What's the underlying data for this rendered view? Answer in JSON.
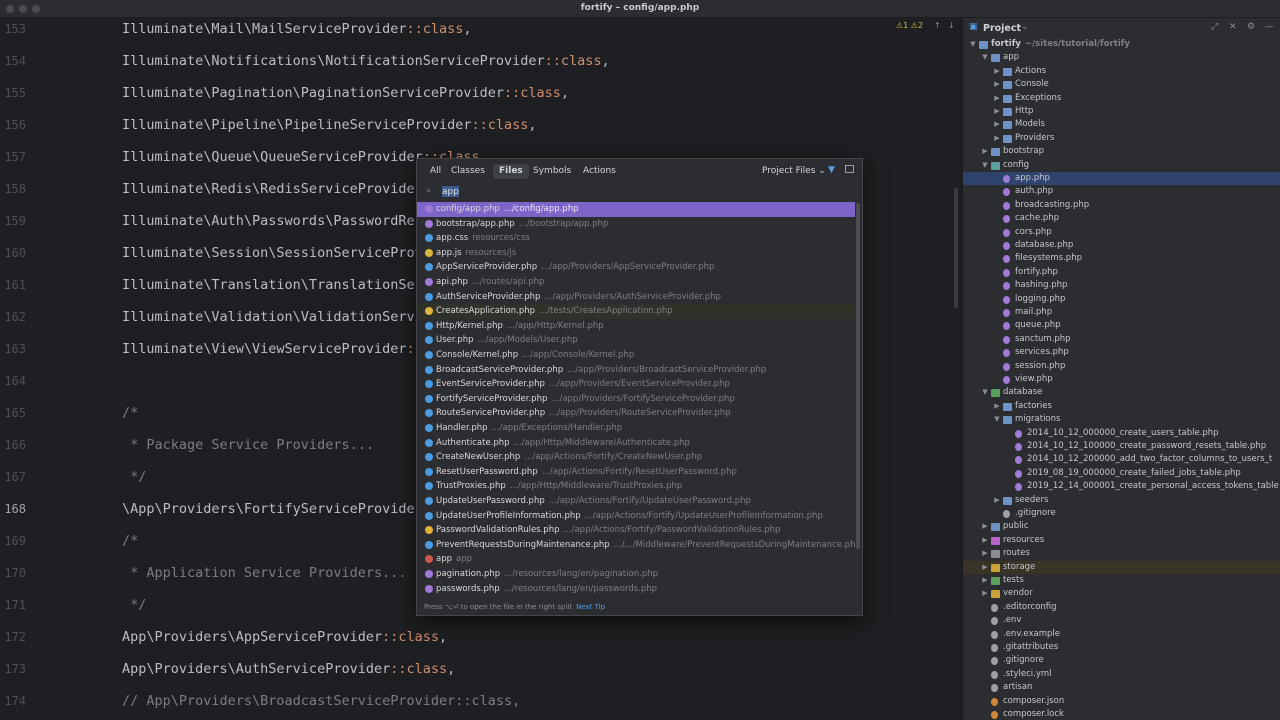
{
  "window": {
    "title": "fortify – config/app.php",
    "inspection_text": "⚠1 ⚠2"
  },
  "editor": {
    "lines": [
      {
        "num": "153",
        "code": "Illuminate\\Mail\\MailServiceProvider::class,"
      },
      {
        "num": "154",
        "code": "Illuminate\\Notifications\\NotificationServiceProvider::class,"
      },
      {
        "num": "155",
        "code": "Illuminate\\Pagination\\PaginationServiceProvider::class,"
      },
      {
        "num": "156",
        "code": "Illuminate\\Pipeline\\PipelineServiceProvider::class,"
      },
      {
        "num": "157",
        "code": "Illuminate\\Queue\\QueueServiceProvider::class,"
      },
      {
        "num": "158",
        "code": "Illuminate\\Redis\\RedisServiceProvider::class,"
      },
      {
        "num": "159",
        "code": "Illuminate\\Auth\\Passwords\\PasswordResetServiceProvider::class,"
      },
      {
        "num": "160",
        "code": "Illuminate\\Session\\SessionServiceProvider::class,"
      },
      {
        "num": "161",
        "code": "Illuminate\\Translation\\TranslationServiceProvider::class,"
      },
      {
        "num": "162",
        "code": "Illuminate\\Validation\\ValidationServiceProvider::class,"
      },
      {
        "num": "163",
        "code": "Illuminate\\View\\ViewServiceProvider::class,"
      },
      {
        "num": "164",
        "code": ""
      },
      {
        "num": "165",
        "code": "/*"
      },
      {
        "num": "166",
        "code": " * Package Service Providers..."
      },
      {
        "num": "167",
        "code": " */"
      },
      {
        "num": "168",
        "code": "\\App\\Providers\\FortifyServiceProvider::class,"
      },
      {
        "num": "169",
        "code": "/*"
      },
      {
        "num": "170",
        "code": " * Application Service Providers..."
      },
      {
        "num": "171",
        "code": " */"
      },
      {
        "num": "172",
        "code": "App\\Providers\\AppServiceProvider::class,"
      },
      {
        "num": "173",
        "code": "App\\Providers\\AuthServiceProvider::class,"
      },
      {
        "num": "174",
        "code": "// App\\Providers\\BroadcastServiceProvider::class,"
      }
    ]
  },
  "popup": {
    "tabs": [
      "All",
      "Classes",
      "Files",
      "Symbols",
      "Actions"
    ],
    "active_tab": "Files",
    "scope": "Project Files",
    "query": "app",
    "results": [
      {
        "name": "config/app.php",
        "path": ".../config/app.php",
        "color": "#a07ad6"
      },
      {
        "name": "bootstrap/app.php",
        "path": ".../bootstrap/app.php",
        "color": "#a07ad6"
      },
      {
        "name": "app.css",
        "path": "resources/css",
        "color": "#4a9be0"
      },
      {
        "name": "app.js",
        "path": "resources/js",
        "color": "#d6b73c"
      },
      {
        "name": "AppServiceProvider.php",
        "path": ".../app/Providers/AppServiceProvider.php",
        "color": "#4a9be0"
      },
      {
        "name": "api.php",
        "path": ".../routes/api.php",
        "color": "#a07ad6"
      },
      {
        "name": "AuthServiceProvider.php",
        "path": ".../app/Providers/AuthServiceProvider.php",
        "color": "#4a9be0"
      },
      {
        "name": "CreatesApplication.php",
        "path": ".../tests/CreatesApplication.php",
        "color": "#e0b33a"
      },
      {
        "name": "Http/Kernel.php",
        "path": ".../app/Http/Kernel.php",
        "color": "#4a9be0"
      },
      {
        "name": "User.php",
        "path": ".../app/Models/User.php",
        "color": "#4a9be0"
      },
      {
        "name": "Console/Kernel.php",
        "path": ".../app/Console/Kernel.php",
        "color": "#4a9be0"
      },
      {
        "name": "BroadcastServiceProvider.php",
        "path": ".../app/Providers/BroadcastServiceProvider.php",
        "color": "#4a9be0"
      },
      {
        "name": "EventServiceProvider.php",
        "path": ".../app/Providers/EventServiceProvider.php",
        "color": "#4a9be0"
      },
      {
        "name": "FortifyServiceProvider.php",
        "path": ".../app/Providers/FortifyServiceProvider.php",
        "color": "#4a9be0"
      },
      {
        "name": "RouteServiceProvider.php",
        "path": ".../app/Providers/RouteServiceProvider.php",
        "color": "#4a9be0"
      },
      {
        "name": "Handler.php",
        "path": ".../app/Exceptions/Handler.php",
        "color": "#4a9be0"
      },
      {
        "name": "Authenticate.php",
        "path": ".../app/Http/Middleware/Authenticate.php",
        "color": "#4a9be0"
      },
      {
        "name": "CreateNewUser.php",
        "path": ".../app/Actions/Fortify/CreateNewUser.php",
        "color": "#4a9be0"
      },
      {
        "name": "ResetUserPassword.php",
        "path": ".../app/Actions/Fortify/ResetUserPassword.php",
        "color": "#4a9be0"
      },
      {
        "name": "TrustProxies.php",
        "path": ".../app/Http/Middleware/TrustProxies.php",
        "color": "#4a9be0"
      },
      {
        "name": "UpdateUserPassword.php",
        "path": ".../app/Actions/Fortify/UpdateUserPassword.php",
        "color": "#4a9be0"
      },
      {
        "name": "UpdateUserProfileInformation.php",
        "path": ".../app/Actions/Fortify/UpdateUserProfileInformation.php",
        "color": "#4a9be0"
      },
      {
        "name": "PasswordValidationRules.php",
        "path": ".../app/Actions/Fortify/PasswordValidationRules.php",
        "color": "#e0b33a"
      },
      {
        "name": "PreventRequestsDuringMaintenance.php",
        "path": ".../.../Middleware/PreventRequestsDuringMaintenance.php",
        "color": "#4a9be0"
      },
      {
        "name": "app",
        "path": "app",
        "color": "#d0574f"
      },
      {
        "name": "pagination.php",
        "path": ".../resources/lang/en/pagination.php",
        "color": "#a07ad6"
      },
      {
        "name": "passwords.php",
        "path": ".../resources/lang/en/passwords.php",
        "color": "#a07ad6"
      }
    ],
    "footer_hint": "Press ⌥⏎ to open the file in the right split",
    "footer_link": "Next Tip"
  },
  "project": {
    "title": "Project",
    "tree": [
      {
        "label": "fortify",
        "extra": "~/sites/tutorial/fortify",
        "depth": 0,
        "arrow": "down",
        "kind": "folder-root"
      },
      {
        "label": "app",
        "depth": 1,
        "arrow": "down",
        "kind": "folder"
      },
      {
        "label": "Actions",
        "depth": 2,
        "arrow": "right",
        "kind": "folder"
      },
      {
        "label": "Console",
        "depth": 2,
        "arrow": "right",
        "kind": "folder"
      },
      {
        "label": "Exceptions",
        "depth": 2,
        "arrow": "right",
        "kind": "folder"
      },
      {
        "label": "Http",
        "depth": 2,
        "arrow": "right",
        "kind": "folder"
      },
      {
        "label": "Models",
        "depth": 2,
        "arrow": "right",
        "kind": "folder"
      },
      {
        "label": "Providers",
        "depth": 2,
        "arrow": "right",
        "kind": "folder"
      },
      {
        "label": "bootstrap",
        "depth": 1,
        "arrow": "right",
        "kind": "folder"
      },
      {
        "label": "config",
        "depth": 1,
        "arrow": "down",
        "kind": "folder-config"
      },
      {
        "label": "app.php",
        "depth": 2,
        "kind": "file",
        "selected": true
      },
      {
        "label": "auth.php",
        "depth": 2,
        "kind": "file"
      },
      {
        "label": "broadcasting.php",
        "depth": 2,
        "kind": "file"
      },
      {
        "label": "cache.php",
        "depth": 2,
        "kind": "file"
      },
      {
        "label": "cors.php",
        "depth": 2,
        "kind": "file"
      },
      {
        "label": "database.php",
        "depth": 2,
        "kind": "file"
      },
      {
        "label": "filesystems.php",
        "depth": 2,
        "kind": "file"
      },
      {
        "label": "fortify.php",
        "depth": 2,
        "kind": "file"
      },
      {
        "label": "hashing.php",
        "depth": 2,
        "kind": "file"
      },
      {
        "label": "logging.php",
        "depth": 2,
        "kind": "file"
      },
      {
        "label": "mail.php",
        "depth": 2,
        "kind": "file"
      },
      {
        "label": "queue.php",
        "depth": 2,
        "kind": "file"
      },
      {
        "label": "sanctum.php",
        "depth": 2,
        "kind": "file"
      },
      {
        "label": "services.php",
        "depth": 2,
        "kind": "file"
      },
      {
        "label": "session.php",
        "depth": 2,
        "kind": "file"
      },
      {
        "label": "view.php",
        "depth": 2,
        "kind": "file"
      },
      {
        "label": "database",
        "depth": 1,
        "arrow": "down",
        "kind": "folder-green"
      },
      {
        "label": "factories",
        "depth": 2,
        "arrow": "right",
        "kind": "folder"
      },
      {
        "label": "migrations",
        "depth": 2,
        "arrow": "down",
        "kind": "folder"
      },
      {
        "label": "2014_10_12_000000_create_users_table.php",
        "depth": 3,
        "kind": "file"
      },
      {
        "label": "2014_10_12_100000_create_password_resets_table.php",
        "depth": 3,
        "kind": "file"
      },
      {
        "label": "2014_10_12_200000_add_two_factor_columns_to_users_t",
        "depth": 3,
        "kind": "file"
      },
      {
        "label": "2019_08_19_000000_create_failed_jobs_table.php",
        "depth": 3,
        "kind": "file"
      },
      {
        "label": "2019_12_14_000001_create_personal_access_tokens_table",
        "depth": 3,
        "kind": "file"
      },
      {
        "label": "seeders",
        "depth": 2,
        "arrow": "right",
        "kind": "folder"
      },
      {
        "label": ".gitignore",
        "depth": 2,
        "kind": "plain"
      },
      {
        "label": "public",
        "depth": 1,
        "arrow": "right",
        "kind": "folder"
      },
      {
        "label": "resources",
        "depth": 1,
        "arrow": "right",
        "kind": "folder-res"
      },
      {
        "label": "routes",
        "depth": 1,
        "arrow": "right",
        "kind": "folder-gray"
      },
      {
        "label": "storage",
        "depth": 1,
        "arrow": "right",
        "kind": "folder-yellow",
        "tint": true
      },
      {
        "label": "tests",
        "depth": 1,
        "arrow": "right",
        "kind": "folder-green"
      },
      {
        "label": "vendor",
        "depth": 1,
        "arrow": "right",
        "kind": "folder-yellow"
      },
      {
        "label": ".editorconfig",
        "depth": 1,
        "kind": "plain"
      },
      {
        "label": ".env",
        "depth": 1,
        "kind": "plain"
      },
      {
        "label": ".env.example",
        "depth": 1,
        "kind": "plain"
      },
      {
        "label": ".gitattributes",
        "depth": 1,
        "kind": "plain"
      },
      {
        "label": ".gitignore",
        "depth": 1,
        "kind": "plain"
      },
      {
        "label": ".styleci.yml",
        "depth": 1,
        "kind": "plain"
      },
      {
        "label": "artisan",
        "depth": 1,
        "kind": "plain"
      },
      {
        "label": "composer.json",
        "depth": 1,
        "kind": "json"
      },
      {
        "label": "composer.lock",
        "depth": 1,
        "kind": "json"
      }
    ]
  }
}
